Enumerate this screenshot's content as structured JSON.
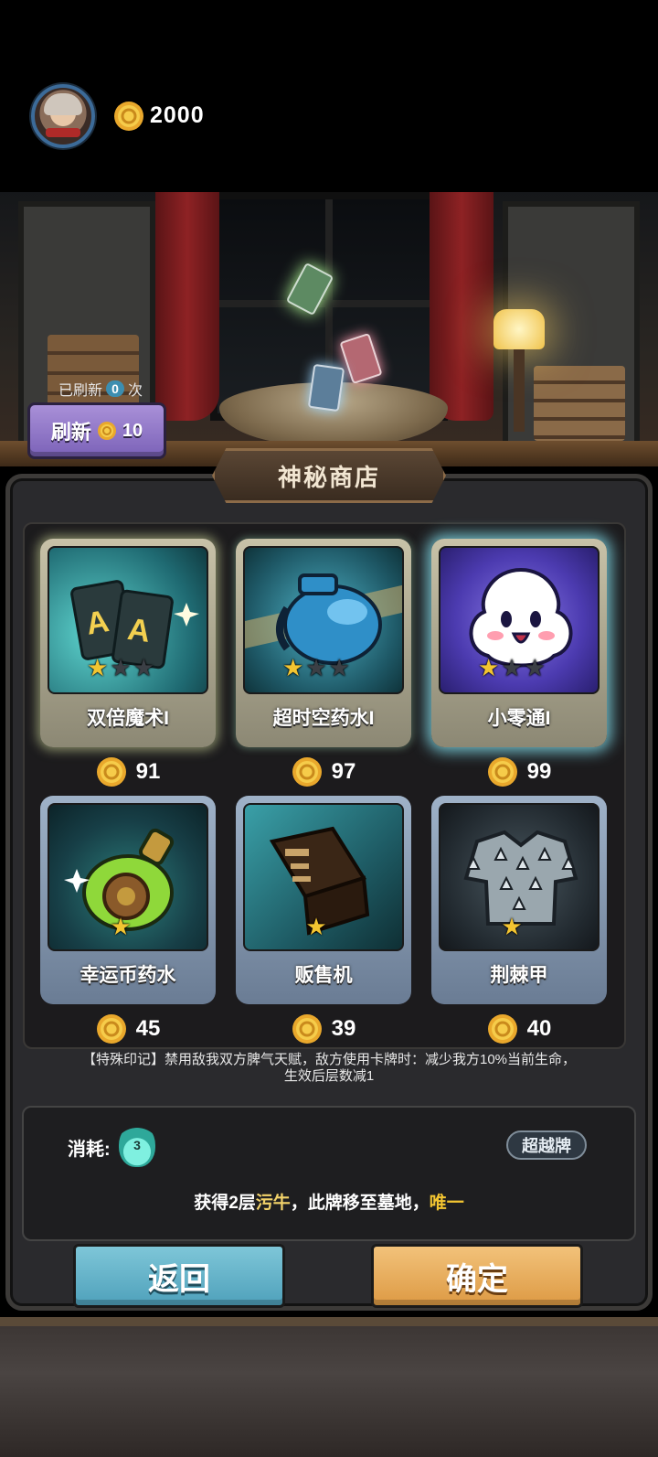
{
  "header": {
    "gold": "2000"
  },
  "refresh": {
    "count_prefix": "已刷新",
    "count": "0",
    "count_suffix": "次",
    "button_label": "刷新",
    "cost": "10"
  },
  "shop": {
    "title": "神秘商店",
    "items": [
      {
        "name": "双倍魔术I",
        "price": "91",
        "stars": 1,
        "max_stars": 3,
        "art": "double-magic-cards-icon"
      },
      {
        "name": "超时空药水I",
        "price": "97",
        "stars": 1,
        "max_stars": 3,
        "art": "time-potion-icon"
      },
      {
        "name": "小零通I",
        "price": "99",
        "stars": 1,
        "max_stars": 3,
        "art": "white-ghost-icon"
      },
      {
        "name": "幸运币药水",
        "price": "45",
        "stars": 1,
        "max_stars": 1,
        "art": "lucky-coin-potion-icon"
      },
      {
        "name": "贩售机",
        "price": "39",
        "stars": 1,
        "max_stars": 1,
        "art": "vending-machine-icon"
      },
      {
        "name": "荆棘甲",
        "price": "40",
        "stars": 1,
        "max_stars": 1,
        "art": "thorn-armor-icon"
      }
    ]
  },
  "detail": {
    "special_mark": "【特殊印记】禁用敌我双方脾气天赋，敌方使用卡牌时：减少我方10%当前生命，",
    "special_mark_2": "生效后层数减1",
    "cost_label": "消耗:",
    "cost_value": "3",
    "card_type": "超越牌",
    "effect_1": "获得2层",
    "effect_hl": "污牛",
    "effect_2": "，此牌移至墓地，",
    "effect_hl2": "唯一"
  },
  "buttons": {
    "back": "返回",
    "confirm": "确定"
  },
  "colors": {
    "gold": "#f3c531",
    "refresh_button": "#8f75c8",
    "back_button": "#6bb5cb",
    "confirm_button": "#e8ad5c",
    "highlight_text": "#f3d36a"
  }
}
